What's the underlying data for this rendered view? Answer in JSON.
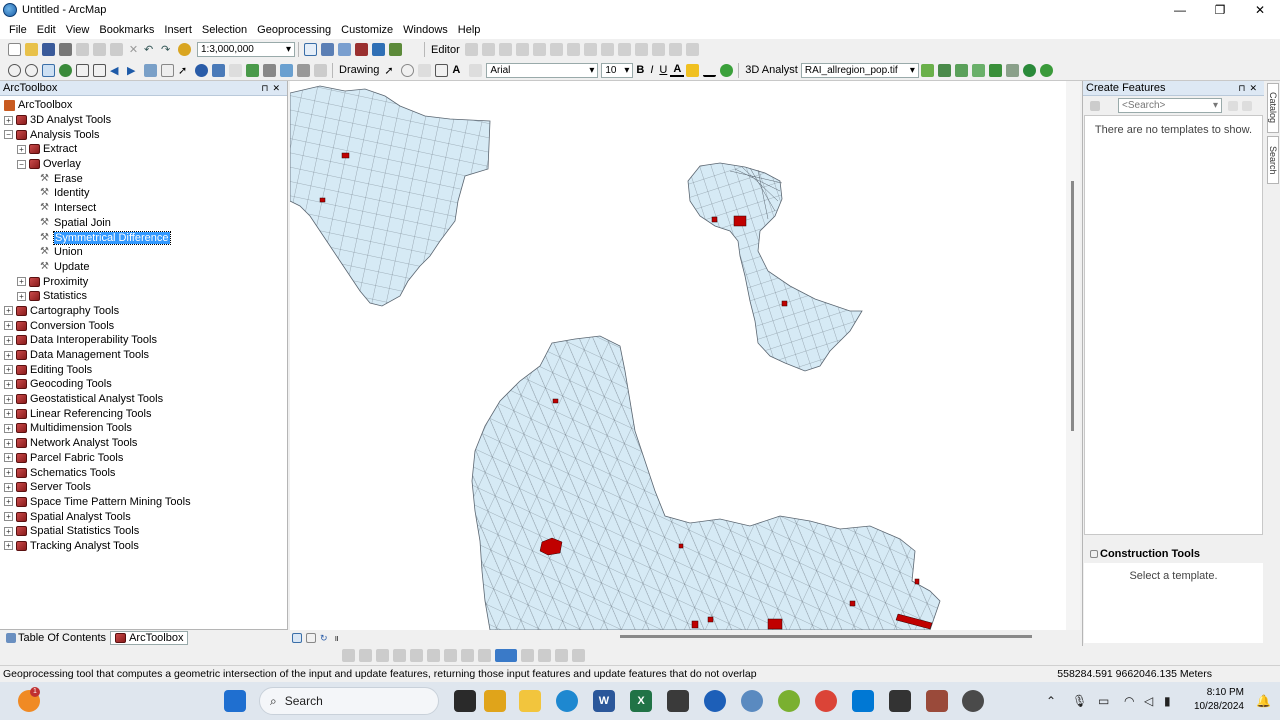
{
  "window": {
    "title": "Untitled - ArcMap",
    "controls": [
      "—",
      "❐",
      "✕"
    ]
  },
  "menu": [
    "File",
    "Edit",
    "View",
    "Bookmarks",
    "Insert",
    "Selection",
    "Geoprocessing",
    "Customize",
    "Windows",
    "Help"
  ],
  "toolbar": {
    "scale": "1:3,000,000",
    "editor_label": "Editor",
    "drawing_label": "Drawing",
    "font_name": "Arial",
    "font_size": "10",
    "bold": "B",
    "italic": "I",
    "underline": "U",
    "font_color": "A",
    "analyst_label": "3D Analyst",
    "layer": "RAI_allregion_pop.tif"
  },
  "toc": {
    "title": "ArcToolbox",
    "items": [
      {
        "label": "ArcToolbox",
        "level": 0,
        "type": "root",
        "exp": ""
      },
      {
        "label": "3D Analyst Tools",
        "level": 0,
        "type": "toolbox",
        "exp": "+"
      },
      {
        "label": "Analysis Tools",
        "level": 0,
        "type": "toolbox",
        "exp": "−"
      },
      {
        "label": "Extract",
        "level": 1,
        "type": "toolbox",
        "exp": "+"
      },
      {
        "label": "Overlay",
        "level": 1,
        "type": "toolbox",
        "exp": "−"
      },
      {
        "label": "Erase",
        "level": 2,
        "type": "tool",
        "exp": ""
      },
      {
        "label": "Identity",
        "level": 2,
        "type": "tool",
        "exp": ""
      },
      {
        "label": "Intersect",
        "level": 2,
        "type": "tool",
        "exp": ""
      },
      {
        "label": "Spatial Join",
        "level": 2,
        "type": "tool",
        "exp": ""
      },
      {
        "label": "Symmetrical Difference",
        "level": 2,
        "type": "tool",
        "exp": "",
        "selected": true
      },
      {
        "label": "Union",
        "level": 2,
        "type": "tool",
        "exp": ""
      },
      {
        "label": "Update",
        "level": 2,
        "type": "tool",
        "exp": ""
      },
      {
        "label": "Proximity",
        "level": 1,
        "type": "toolbox",
        "exp": "+"
      },
      {
        "label": "Statistics",
        "level": 1,
        "type": "toolbox",
        "exp": "+"
      },
      {
        "label": "Cartography Tools",
        "level": 0,
        "type": "toolbox",
        "exp": "+"
      },
      {
        "label": "Conversion Tools",
        "level": 0,
        "type": "toolbox",
        "exp": "+"
      },
      {
        "label": "Data Interoperability Tools",
        "level": 0,
        "type": "toolbox",
        "exp": "+"
      },
      {
        "label": "Data Management Tools",
        "level": 0,
        "type": "toolbox",
        "exp": "+"
      },
      {
        "label": "Editing Tools",
        "level": 0,
        "type": "toolbox",
        "exp": "+"
      },
      {
        "label": "Geocoding Tools",
        "level": 0,
        "type": "toolbox",
        "exp": "+"
      },
      {
        "label": "Geostatistical Analyst Tools",
        "level": 0,
        "type": "toolbox",
        "exp": "+"
      },
      {
        "label": "Linear Referencing Tools",
        "level": 0,
        "type": "toolbox",
        "exp": "+"
      },
      {
        "label": "Multidimension Tools",
        "level": 0,
        "type": "toolbox",
        "exp": "+"
      },
      {
        "label": "Network Analyst Tools",
        "level": 0,
        "type": "toolbox",
        "exp": "+"
      },
      {
        "label": "Parcel Fabric Tools",
        "level": 0,
        "type": "toolbox",
        "exp": "+"
      },
      {
        "label": "Schematics Tools",
        "level": 0,
        "type": "toolbox",
        "exp": "+"
      },
      {
        "label": "Server Tools",
        "level": 0,
        "type": "toolbox",
        "exp": "+"
      },
      {
        "label": "Space Time Pattern Mining Tools",
        "level": 0,
        "type": "toolbox",
        "exp": "+"
      },
      {
        "label": "Spatial Analyst Tools",
        "level": 0,
        "type": "toolbox",
        "exp": "+"
      },
      {
        "label": "Spatial Statistics Tools",
        "level": 0,
        "type": "toolbox",
        "exp": "+"
      },
      {
        "label": "Tracking Analyst Tools",
        "level": 0,
        "type": "toolbox",
        "exp": "+"
      }
    ],
    "tabs": [
      "Table Of Contents",
      "ArcToolbox"
    ]
  },
  "right_panel": {
    "title": "Create Features",
    "search_placeholder": "<Search>",
    "empty_text": "There are no templates to show.",
    "construction_title": "Construction Tools",
    "construction_empty": "Select a template.",
    "side_tabs": [
      "Catalog",
      "Search"
    ]
  },
  "map": {
    "fill_color": "#d6eaf5",
    "highlight_color": "#c00000",
    "stroke_color": "#5a6570"
  },
  "status": {
    "message": "Geoprocessing tool that computes a geometric intersection of the input and update features, returning those input features and update features that do not overlap",
    "coords": "558284.591  9662046.135 Meters"
  },
  "taskbar": {
    "search": "Search",
    "time": "8:10 PM",
    "date": "10/28/2024",
    "notification_count": "1"
  }
}
